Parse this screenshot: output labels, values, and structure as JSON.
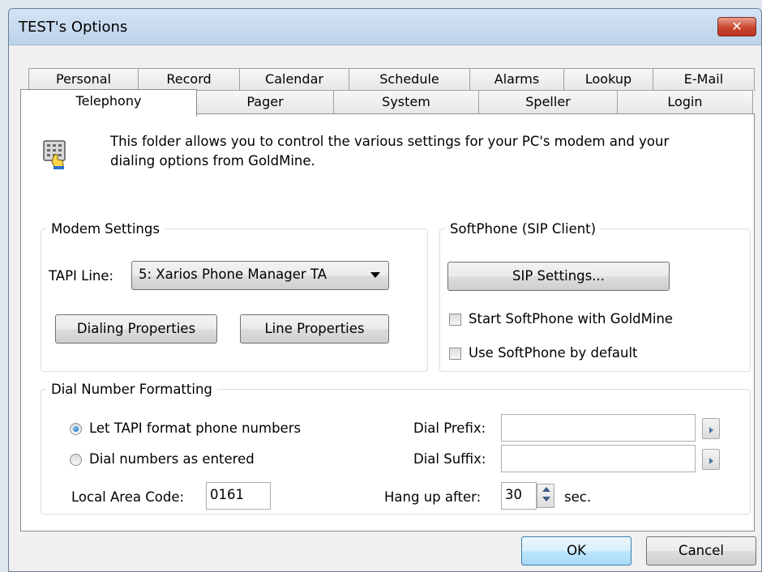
{
  "window": {
    "title": "TEST's Options",
    "close_label": "✕"
  },
  "tabs_row1": [
    "Personal",
    "Record",
    "Calendar",
    "Schedule",
    "Alarms",
    "Lookup",
    "E-Mail"
  ],
  "tabs_row2": [
    "Telephony",
    "Pager",
    "System",
    "Speller",
    "Login"
  ],
  "active_tab": "Telephony",
  "info": {
    "line1": "This folder allows you to control the various settings for your PC's modem and your",
    "line2": "dialing options from GoldMine.",
    "icon": "keypad-hand-icon"
  },
  "modem": {
    "legend": "Modem Settings",
    "tapi_label": "TAPI Line:",
    "tapi_value": "5: Xarios Phone Manager TA",
    "dialing_button": "Dialing Properties",
    "line_button": "Line Properties"
  },
  "softphone": {
    "legend": "SoftPhone (SIP Client)",
    "sip_button": "SIP Settings...",
    "start_label": "Start SoftPhone with GoldMine",
    "start_checked": false,
    "default_label": "Use SoftPhone by default",
    "default_checked": false
  },
  "dial": {
    "legend": "Dial Number Formatting",
    "radio1_label": "Let TAPI format phone numbers",
    "radio1_selected": true,
    "radio2_label": "Dial numbers as entered",
    "radio2_selected": false,
    "local_area_label": "Local Area Code:",
    "local_area_value": "0161",
    "prefix_label": "Dial Prefix:",
    "prefix_value": "",
    "suffix_label": "Dial Suffix:",
    "suffix_value": "",
    "hangup_label": "Hang up after:",
    "hangup_value": "30",
    "sec_label": "sec."
  },
  "footer": {
    "ok_label": "OK",
    "cancel_label": "Cancel"
  },
  "colors": {
    "close": "#c9452e",
    "focus_border": "#3c7fb1",
    "radio_dot": "#1a6ec0"
  }
}
